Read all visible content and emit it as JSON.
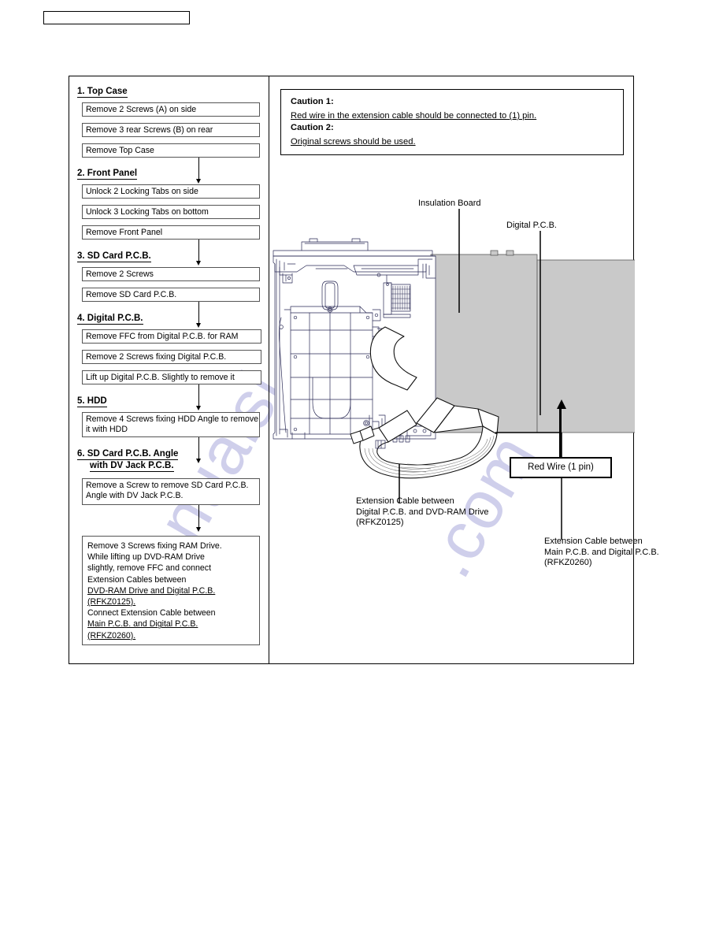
{
  "page": {
    "header_label": ""
  },
  "flow": {
    "sections": [
      {
        "heading": "1. Top Case",
        "steps": [
          "Remove 2 Screws (A) on side",
          "Remove 3 rear Screws (B) on rear",
          "Remove Top Case"
        ]
      },
      {
        "heading": "2. Front Panel",
        "steps": [
          "Unlock 2 Locking Tabs on side",
          "Unlock 3 Locking Tabs on bottom",
          "Remove Front Panel"
        ]
      },
      {
        "heading": "3. SD Card P.C.B.",
        "steps": [
          "Remove 2 Screws",
          "Remove SD Card P.C.B."
        ]
      },
      {
        "heading": "4. Digital P.C.B.",
        "steps": [
          "Remove FFC from Digital P.C.B. for RAM",
          "Remove 2 Screws fixing Digital P.C.B.",
          "Lift up Digital P.C.B. Slightly to remove it"
        ]
      },
      {
        "heading": "5. HDD",
        "steps": [
          "Remove 4 Screws fixing HDD Angle to remove it with HDD"
        ]
      },
      {
        "heading": "6. SD Card P.C.B. Angle",
        "heading_line2": "with DV Jack P.C.B.",
        "steps": [
          "Remove a Screw to remove SD Card P.C.B. Angle with DV Jack P.C.B."
        ]
      }
    ],
    "final_step": {
      "line1": "Remove 3  Screws fixing RAM Drive.",
      "line2": "While lifting up DVD-RAM Drive",
      "line3": "slightly, remove FFC and connect",
      "line4": "Extension Cables between",
      "line5": "DVD-RAM Drive and Digital P.C.B.",
      "line6": "(RFKZ0125).",
      "line7": "Connect Extension Cable between",
      "line8": "Main P.C.B. and Digital P.C.B.",
      "line9": "(RFKZ0260)."
    }
  },
  "caution": {
    "title1": "Caution 1:",
    "body1": "Red wire in the extension cable should be connected to (1) pin.",
    "title2": "Caution 2:",
    "body2": "Original screws should be used."
  },
  "diagram": {
    "label_insulation_board": "Insulation Board",
    "label_digital_pcb": "Digital P.C.B.",
    "label_red_wire": "Red Wire (1 pin)",
    "callout_left": {
      "line1": "Extension Cable between",
      "line2": "Digital P.C.B. and DVD-RAM Drive",
      "line3": "(RFKZ0125)"
    },
    "callout_right": {
      "line1": "Extension Cable between",
      "line2": "Main P.C.B. and Digital P.C.B.",
      "line3": "(RFKZ0260)"
    }
  },
  "watermark": {
    "text_a": "manualsl",
    "text_b": ".com"
  },
  "colors": {
    "pcb_gray": "#c9c9c9",
    "watermark": "#a9a8dc",
    "line": "#000000"
  }
}
